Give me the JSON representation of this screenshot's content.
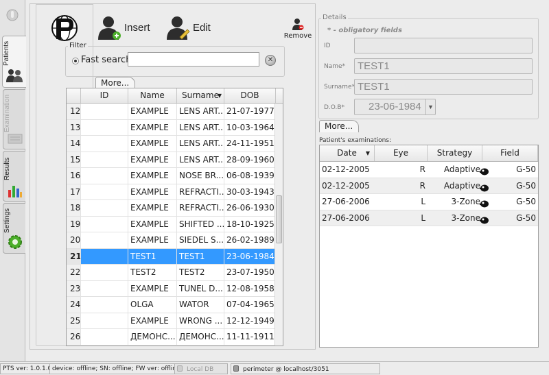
{
  "sidebar": {
    "tabs": [
      {
        "label": "Patients",
        "icon": "patients-icon",
        "active": true
      },
      {
        "label": "Examination",
        "icon": "examination-icon",
        "disabled": true
      },
      {
        "label": "Results",
        "icon": "results-chart-icon"
      },
      {
        "label": "Settings",
        "icon": "settings-gear-icon"
      }
    ]
  },
  "toolbar": {
    "insert_label": "Insert",
    "edit_label": "Edit",
    "remove_label": "Remove"
  },
  "filter": {
    "title": "Filter",
    "fast_search_label": "Fast search",
    "search_value": "",
    "more_label": "More..."
  },
  "patients_table": {
    "headers": [
      "",
      "ID",
      "Name",
      "Surname",
      "DOB"
    ],
    "rows": [
      {
        "n": "12",
        "id": "",
        "name": "EXAMPLE",
        "surname": "LENS ART...",
        "dob": "21-07-1977"
      },
      {
        "n": "13",
        "id": "",
        "name": "EXAMPLE",
        "surname": "LENS ART...",
        "dob": "10-03-1964"
      },
      {
        "n": "14",
        "id": "",
        "name": "EXAMPLE",
        "surname": "LENS ART...",
        "dob": "24-11-1951"
      },
      {
        "n": "15",
        "id": "",
        "name": "EXAMPLE",
        "surname": "LENS ART...",
        "dob": "28-09-1960"
      },
      {
        "n": "16",
        "id": "",
        "name": "EXAMPLE",
        "surname": "NOSE BR...",
        "dob": "06-08-1939"
      },
      {
        "n": "17",
        "id": "",
        "name": "EXAMPLE",
        "surname": "REFRACTI...",
        "dob": "30-03-1943"
      },
      {
        "n": "18",
        "id": "",
        "name": "EXAMPLE",
        "surname": "REFRACTI...",
        "dob": "26-06-1930"
      },
      {
        "n": "19",
        "id": "",
        "name": "EXAMPLE",
        "surname": "SHIFTED ...",
        "dob": "18-10-1925"
      },
      {
        "n": "20",
        "id": "",
        "name": "EXAMPLE",
        "surname": "SIEDEL S...",
        "dob": "26-02-1989"
      },
      {
        "n": "21",
        "id": "",
        "name": "TEST1",
        "surname": "TEST1",
        "dob": "23-06-1984",
        "selected": true
      },
      {
        "n": "22",
        "id": "",
        "name": "TEST2",
        "surname": "TEST2",
        "dob": "23-07-1950"
      },
      {
        "n": "23",
        "id": "",
        "name": "EXAMPLE",
        "surname": "TUNEL D...",
        "dob": "12-08-1958"
      },
      {
        "n": "24",
        "id": "",
        "name": "OLGA",
        "surname": "WATOR",
        "dob": "07-04-1965"
      },
      {
        "n": "25",
        "id": "",
        "name": "EXAMPLE",
        "surname": "WRONG ...",
        "dob": "12-12-1949"
      },
      {
        "n": "26",
        "id": "",
        "name": "ДЕМОНС...",
        "surname": "ДЕМОНС...",
        "dob": "11-11-1911"
      }
    ]
  },
  "details": {
    "title": "Details",
    "obligatory_note": "* - obligatory fields",
    "id_label": "ID",
    "id_value": "",
    "name_label": "Name*",
    "name_value": "TEST1",
    "surname_label": "Surname*",
    "surname_value": "TEST1",
    "dob_label": "D.O.B*",
    "dob_value": "23-06-1984",
    "more_label": "More..."
  },
  "examinations": {
    "title": "Patient's examinations:",
    "headers": [
      "Date",
      "Eye",
      "Strategy",
      "Field"
    ],
    "rows": [
      {
        "date": "02-12-2005",
        "eye": "R",
        "strategy": "Adaptive",
        "field": "G-50"
      },
      {
        "date": "02-12-2005",
        "eye": "R",
        "strategy": "Adaptive",
        "field": "G-50"
      },
      {
        "date": "27-06-2006",
        "eye": "L",
        "strategy": "3-Zone",
        "field": "G-50"
      },
      {
        "date": "27-06-2006",
        "eye": "L",
        "strategy": "3-Zone",
        "field": "G-50"
      }
    ]
  },
  "statusbar": {
    "version": "PTS ver: 1.0.1.0",
    "device": "device: offline; SN: offline; FW ver: offline",
    "local_db": "Local DB",
    "connection": "perimeter @ localhost/3051"
  },
  "colors": {
    "selection": "#3399ff",
    "accent_green": "#4caf2a"
  }
}
